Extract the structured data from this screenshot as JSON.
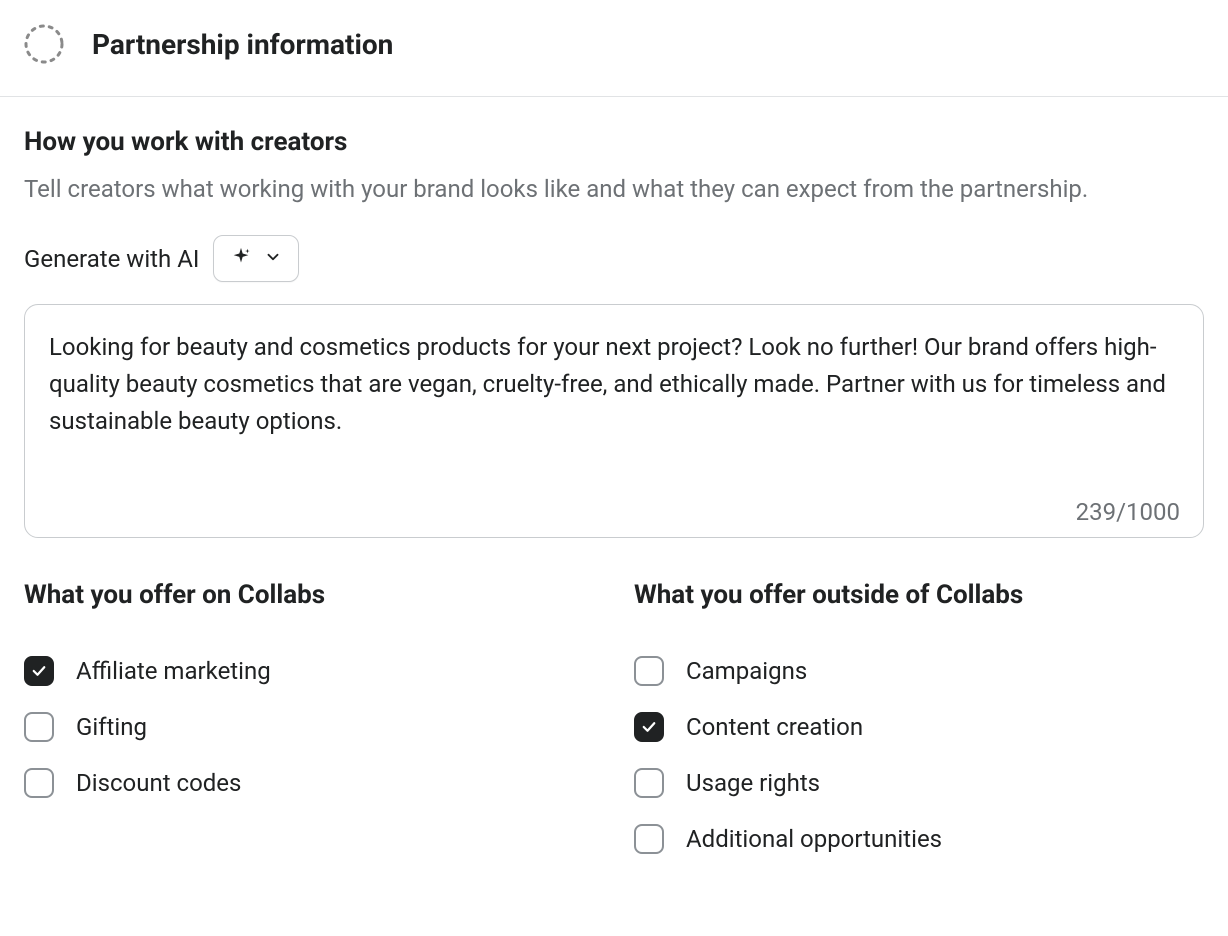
{
  "header": {
    "title": "Partnership information"
  },
  "section": {
    "heading": "How you work with creators",
    "description": "Tell creators what working with your brand looks like and what they can expect from the partnership.",
    "generate_label": "Generate with AI"
  },
  "textarea": {
    "value": "Looking for beauty and cosmetics products for your next project? Look no further! Our brand offers high-quality beauty cosmetics that are vegan, cruelty-free, and ethically made. Partner with us for timeless and sustainable beauty options.",
    "counter": "239/1000"
  },
  "offers_on": {
    "heading": "What you offer on Collabs",
    "items": [
      {
        "label": "Affiliate marketing",
        "checked": true
      },
      {
        "label": "Gifting",
        "checked": false
      },
      {
        "label": "Discount codes",
        "checked": false
      }
    ]
  },
  "offers_outside": {
    "heading": "What you offer outside of Collabs",
    "items": [
      {
        "label": "Campaigns",
        "checked": false
      },
      {
        "label": "Content creation",
        "checked": true
      },
      {
        "label": "Usage rights",
        "checked": false
      },
      {
        "label": "Additional opportunities",
        "checked": false
      }
    ]
  }
}
